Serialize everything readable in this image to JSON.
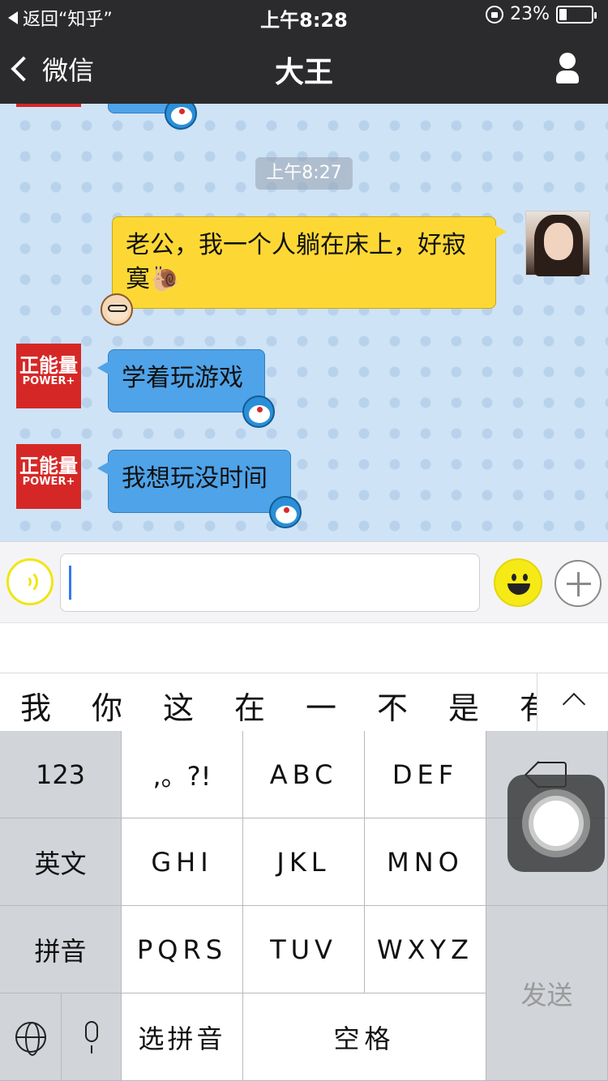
{
  "status_bar": {
    "back_app": "返回“知乎”",
    "time": "上午8:28",
    "battery": "23%",
    "battery_level": 0.23
  },
  "nav": {
    "back_label": "微信",
    "title": "大王",
    "profile_icon": "person-icon"
  },
  "chat": {
    "timestamp": "上午8:27",
    "messages": [
      {
        "side": "right",
        "sender": "self",
        "text": "老公，我一个人躺在床上，好寂寞",
        "emoji": "🐌"
      },
      {
        "side": "left",
        "sender": "正能量 POWER+",
        "text": "学着玩游戏"
      },
      {
        "side": "left",
        "sender": "正能量 POWER+",
        "text": "我想玩没时间"
      }
    ],
    "avatar_text": {
      "big": "正能量",
      "small": "POWER+"
    }
  },
  "input": {
    "voice_icon": "voice-icon",
    "emoji_icon": "emoji-icon",
    "plus_icon": "plus-icon",
    "value": ""
  },
  "candidates": [
    "我",
    "你",
    "这",
    "在",
    "一",
    "不",
    "是",
    "有"
  ],
  "keyboard": {
    "rows": [
      [
        "123",
        ",。?!",
        "ABC",
        "DEF"
      ],
      [
        "英文",
        "GHI",
        "JKL",
        "MNO"
      ],
      [
        "拼音",
        "PQRS",
        "TUV",
        "WXYZ"
      ]
    ],
    "bottom": {
      "select_pinyin": "选拼音",
      "space": "空格"
    },
    "send": "发送"
  }
}
